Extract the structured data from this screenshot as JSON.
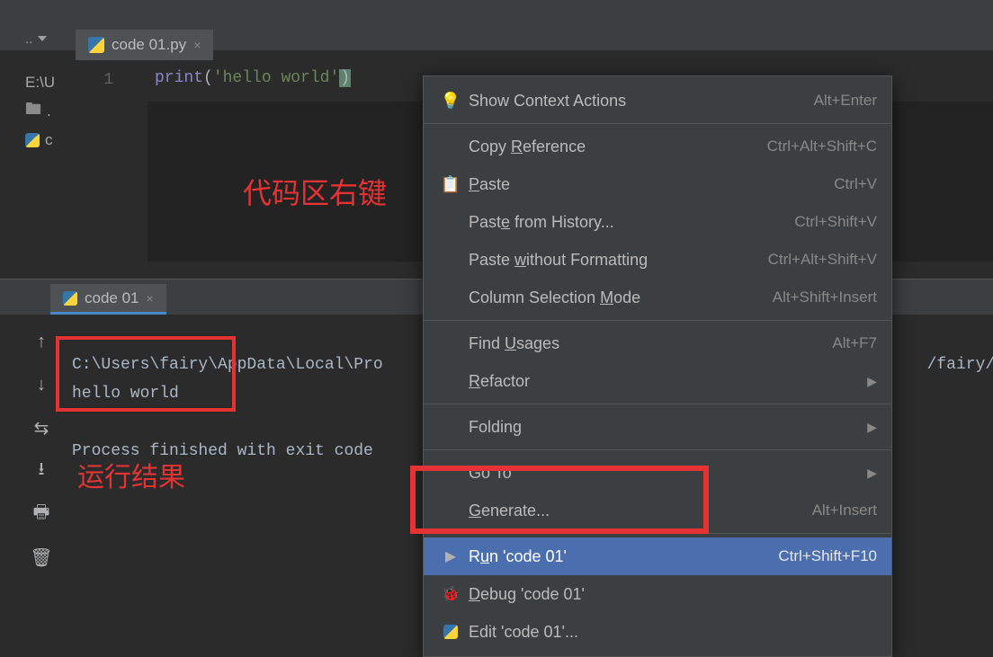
{
  "tab": {
    "filename": "code 01.py"
  },
  "sidebar": {
    "root": "E:\\U",
    "folder": ".",
    "file_trunc": "c"
  },
  "editor": {
    "line_no": "1",
    "code": {
      "func": "print",
      "arg": "'hello world'"
    }
  },
  "annotations": {
    "code_area": "代码区右键",
    "run_result": "运行结果"
  },
  "run": {
    "tab_name": "code 01",
    "line1": "C:\\Users\\fairy\\AppData\\Local\\Pro",
    "line1b": "/fairy/",
    "line2": "hello world",
    "line3": "",
    "line4": "Process finished with exit code "
  },
  "menu": {
    "show_context": {
      "label": "Show Context Actions",
      "shortcut": "Alt+Enter"
    },
    "copy_ref": {
      "label_pre": "Copy ",
      "u": "R",
      "label_post": "eference",
      "shortcut": "Ctrl+Alt+Shift+C"
    },
    "paste": {
      "u": "P",
      "label_post": "aste",
      "shortcut": "Ctrl+V"
    },
    "paste_hist": {
      "label_pre": "Past",
      "u": "e",
      "label_post": " from History...",
      "shortcut": "Ctrl+Shift+V"
    },
    "paste_nofmt": {
      "label_pre": "Paste ",
      "u": "w",
      "label_post": "ithout Formatting",
      "shortcut": "Ctrl+Alt+Shift+V"
    },
    "col_sel": {
      "label_pre": "Column Selection ",
      "u": "M",
      "label_post": "ode",
      "shortcut": "Alt+Shift+Insert"
    },
    "find_usages": {
      "label_pre": "Find ",
      "u": "U",
      "label_post": "sages",
      "shortcut": "Alt+F7"
    },
    "refactor": {
      "u": "R",
      "label_post": "efactor"
    },
    "folding": {
      "label": "Folding"
    },
    "goto": {
      "label": "Go To"
    },
    "generate": {
      "label_pre": "",
      "u": "G",
      "label_post": "enerate...",
      "shortcut": "Alt+Insert"
    },
    "run_item": {
      "label_pre": "R",
      "u": "u",
      "label_post": "n 'code 01'",
      "shortcut": "Ctrl+Shift+F10"
    },
    "debug": {
      "u": "D",
      "label_post": "ebug 'code 01'"
    },
    "edit": {
      "label": "Edit 'code 01'..."
    }
  }
}
